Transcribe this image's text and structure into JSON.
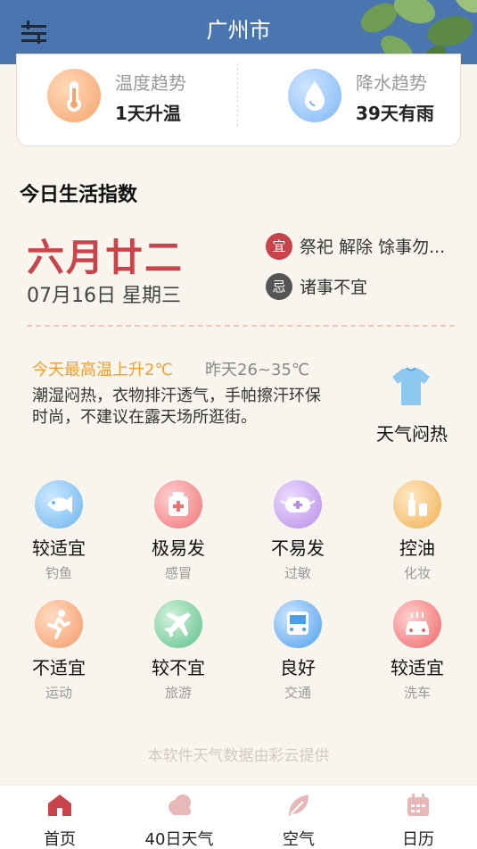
{
  "header": {
    "city": "广州市",
    "menu_icon": "menu-icon"
  },
  "trends": {
    "temperature": {
      "title": "温度趋势",
      "value": "1天升温",
      "icon": "thermometer-icon"
    },
    "precipitation": {
      "title": "降水趋势",
      "value": "39天有雨",
      "icon": "water-drop-icon"
    }
  },
  "section_title": "今日生活指数",
  "almanac": {
    "lunar_date": "六月廿二",
    "gregorian_date": "07月16日 星期三",
    "yi": {
      "badge": "宜",
      "text": "祭祀 解除 馀事勿..."
    },
    "ji": {
      "badge": "忌",
      "text": "诸事不宜"
    }
  },
  "weather": {
    "temp_rise": "今天最高温上升2℃",
    "yesterday": "昨天26~35℃",
    "advice": "潮湿闷热，衣物排汗透气，手帕擦汗环保时尚，不建议在露天场所逛街。",
    "condition": "天气闷热",
    "condition_icon": "t-shirt-icon"
  },
  "indices": [
    {
      "level": "较适宜",
      "name": "钓鱼",
      "icon": "fish-icon",
      "color": "#5aaeea"
    },
    {
      "level": "极易发",
      "name": "感冒",
      "icon": "medkit-icon",
      "color": "#ef6e72"
    },
    {
      "level": "不易发",
      "name": "过敏",
      "icon": "mask-icon",
      "color": "#b58be8"
    },
    {
      "level": "控油",
      "name": "化妆",
      "icon": "cosmetics-icon",
      "color": "#f0b050"
    },
    {
      "level": "不适宜",
      "name": "运动",
      "icon": "running-icon",
      "color": "#f59a66"
    },
    {
      "level": "较不宜",
      "name": "旅游",
      "icon": "airplane-icon",
      "color": "#5bc088"
    },
    {
      "level": "良好",
      "name": "交通",
      "icon": "bus-icon",
      "color": "#4b9eea"
    },
    {
      "level": "较适宜",
      "name": "洗车",
      "icon": "car-wash-icon",
      "color": "#ef6466"
    }
  ],
  "footer_note": "本软件天气数据由彩云提供",
  "nav": [
    {
      "label": "首页",
      "icon": "home-icon"
    },
    {
      "label": "40日天气",
      "icon": "cloud-icon"
    },
    {
      "label": "空气",
      "icon": "leaf-icon"
    },
    {
      "label": "日历",
      "icon": "calendar-icon"
    }
  ],
  "colors": {
    "header_bg": "#4a76b0",
    "accent_red": "#c9434a",
    "nav_active": "#c9434a",
    "nav_inactive": "#e8b8b8"
  }
}
